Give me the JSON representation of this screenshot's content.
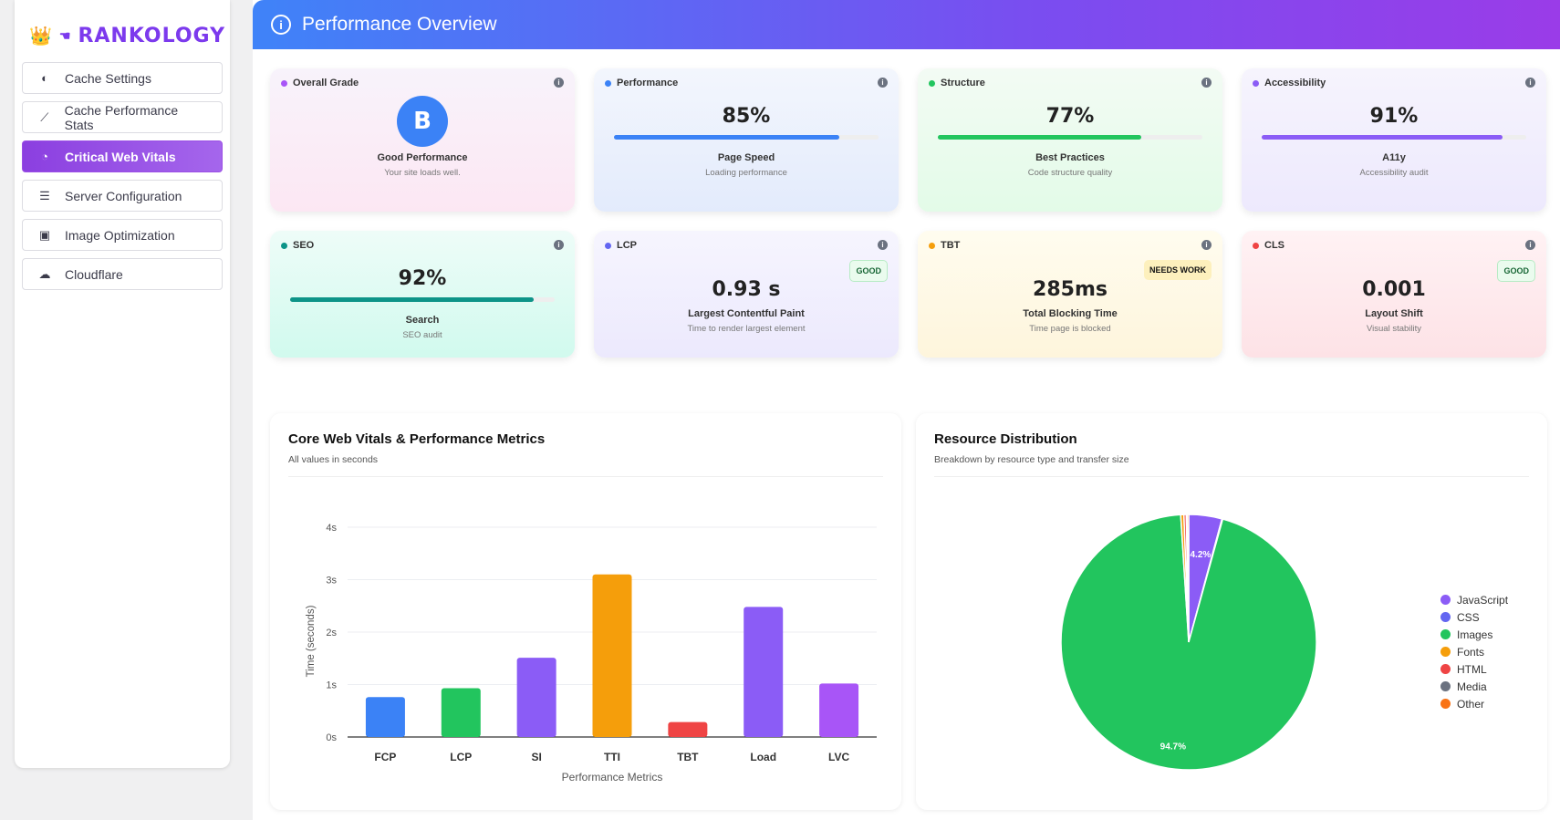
{
  "brand": {
    "name": "RANKOLOGY",
    "crown": "👑",
    "hand": "☚"
  },
  "sidebar": {
    "items": [
      {
        "label": "Cache Settings",
        "icon": "toggle-icon",
        "glyph": "◐"
      },
      {
        "label": "Cache Performance Stats",
        "icon": "chart-line-icon",
        "glyph": "⟋"
      },
      {
        "label": "Critical Web Vitals",
        "icon": "gauge-icon",
        "glyph": "◔",
        "active": true
      },
      {
        "label": "Server Configuration",
        "icon": "server-icon",
        "glyph": "☰"
      },
      {
        "label": "Image Optimization",
        "icon": "image-icon",
        "glyph": "▣"
      },
      {
        "label": "Cloudflare",
        "icon": "cloud-icon",
        "glyph": "☁"
      }
    ]
  },
  "header": {
    "title": "Performance Overview",
    "icon": "info-icon"
  },
  "cards": {
    "grade": {
      "label": "Overall Grade",
      "grade": "B",
      "title": "Good Performance",
      "sub": "Your site loads well.",
      "color": "#a855f7"
    },
    "performance": {
      "label": "Performance",
      "value": "85%",
      "percent": 85,
      "title": "Page Speed",
      "sub": "Loading performance",
      "color": "#3b82f6"
    },
    "structure": {
      "label": "Structure",
      "value": "77%",
      "percent": 77,
      "title": "Best Practices",
      "sub": "Code structure quality",
      "color": "#22c55e"
    },
    "accessibility": {
      "label": "Accessibility",
      "value": "91%",
      "percent": 91,
      "title": "A11y",
      "sub": "Accessibility audit",
      "color": "#8b5cf6"
    },
    "seo": {
      "label": "SEO",
      "value": "92%",
      "percent": 92,
      "title": "Search",
      "sub": "SEO audit",
      "color": "#0d9488"
    },
    "lcp": {
      "label": "LCP",
      "value": "0.93 s",
      "title": "Largest Contentful Paint",
      "sub": "Time to render largest element",
      "badge": "GOOD",
      "color": "#6366f1"
    },
    "tbt": {
      "label": "TBT",
      "value": "285ms",
      "title": "Total Blocking Time",
      "sub": "Time page is blocked",
      "badge": "NEEDS WORK",
      "color": "#f59e0b"
    },
    "cls": {
      "label": "CLS",
      "value": "0.001",
      "title": "Layout Shift",
      "sub": "Visual stability",
      "badge": "GOOD",
      "color": "#ef4444"
    }
  },
  "chart_data": [
    {
      "type": "bar",
      "title": "Core Web Vitals & Performance Metrics",
      "subtitle": "All values in seconds",
      "xlabel": "Performance Metrics",
      "ylabel": "Time (seconds)",
      "ylim": [
        0,
        4
      ],
      "yticks": [
        "0s",
        "1s",
        "2s",
        "3s",
        "4s"
      ],
      "grid": true,
      "categories": [
        "FCP",
        "LCP",
        "SI",
        "TTI",
        "TBT",
        "Load",
        "LVC"
      ],
      "values": [
        0.76,
        0.93,
        1.51,
        3.1,
        0.285,
        2.48,
        1.02
      ],
      "colors": [
        "#3b82f6",
        "#22c55e",
        "#8b5cf6",
        "#f59e0b",
        "#ef4444",
        "#8b5cf6",
        "#a855f7"
      ]
    },
    {
      "type": "pie",
      "title": "Resource Distribution",
      "subtitle": "Breakdown by resource type and transfer size",
      "legend": "right",
      "categories": [
        "JavaScript",
        "CSS",
        "Images",
        "Fonts",
        "HTML",
        "Media",
        "Other"
      ],
      "values": [
        4.2,
        0.1,
        94.7,
        0.4,
        0.3,
        0.1,
        0.2
      ],
      "labels": [
        "4.2%",
        "",
        "94.7%",
        "",
        "",
        "",
        ""
      ],
      "colors": [
        "#8b5cf6",
        "#6366f1",
        "#22c55e",
        "#f59e0b",
        "#ef4444",
        "#6b7280",
        "#f97316"
      ]
    }
  ]
}
